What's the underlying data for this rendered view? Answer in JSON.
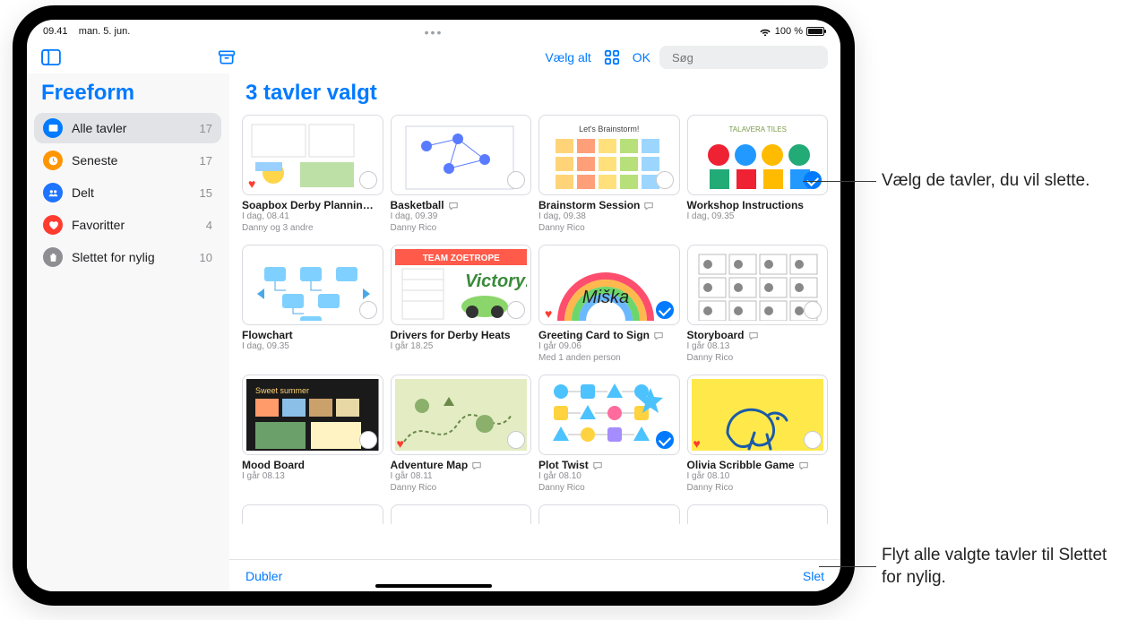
{
  "statusbar": {
    "time": "09.41",
    "date": "man. 5. jun.",
    "battery": "100 %"
  },
  "toolbar": {
    "select_all": "Vælg alt",
    "done": "OK",
    "search_placeholder": "Søg"
  },
  "sidebar": {
    "title": "Freeform",
    "items": [
      {
        "icon": "board",
        "color": "#007aff",
        "label": "Alle tavler",
        "count": "17",
        "active": true
      },
      {
        "icon": "clock",
        "color": "#ff9500",
        "label": "Seneste",
        "count": "17",
        "active": false
      },
      {
        "icon": "people",
        "color": "#1e73ff",
        "label": "Delt",
        "count": "15",
        "active": false
      },
      {
        "icon": "heart",
        "color": "#ff3b30",
        "label": "Favoritter",
        "count": "4",
        "active": false
      },
      {
        "icon": "trash",
        "color": "#8e8e93",
        "label": "Slettet for nylig",
        "count": "10",
        "active": false
      }
    ]
  },
  "main": {
    "header": "3 tavler valgt"
  },
  "boards": [
    {
      "title": "Soapbox Derby Plannin…",
      "sub1": "I dag, 08.41",
      "sub2": "Danny og 3 andre",
      "shared": false,
      "fav": true,
      "selected": false,
      "art": "art-derby"
    },
    {
      "title": "Basketball",
      "sub1": "I dag, 09.39",
      "sub2": "Danny Rico",
      "shared": true,
      "fav": false,
      "selected": false,
      "art": "art-graph"
    },
    {
      "title": "Brainstorm Session",
      "sub1": "I dag, 09.38",
      "sub2": "Danny Rico",
      "shared": true,
      "fav": false,
      "selected": false,
      "art": "art-sticky"
    },
    {
      "title": "Workshop Instructions",
      "sub1": "I dag, 09.35",
      "sub2": "",
      "shared": false,
      "fav": false,
      "selected": true,
      "art": "art-tiles"
    },
    {
      "title": "Flowchart",
      "sub1": "I dag, 09.35",
      "sub2": "",
      "shared": false,
      "fav": false,
      "selected": false,
      "art": "art-flow"
    },
    {
      "title": "Drivers for Derby Heats",
      "sub1": "I går 18.25",
      "sub2": "",
      "shared": false,
      "fav": false,
      "selected": false,
      "art": "art-zoe"
    },
    {
      "title": "Greeting Card to Sign",
      "sub1": "I går 09.06",
      "sub2": "Med 1 anden person",
      "shared": true,
      "fav": true,
      "selected": true,
      "art": "art-rainbow"
    },
    {
      "title": "Storyboard",
      "sub1": "I går 08.13",
      "sub2": "Danny Rico",
      "shared": true,
      "fav": false,
      "selected": false,
      "art": "art-story"
    },
    {
      "title": "Mood Board",
      "sub1": "I går 08.13",
      "sub2": "",
      "shared": false,
      "fav": false,
      "selected": false,
      "art": "art-photos"
    },
    {
      "title": "Adventure Map",
      "sub1": "I går 08.11",
      "sub2": "Danny Rico",
      "shared": true,
      "fav": true,
      "selected": false,
      "art": "art-map"
    },
    {
      "title": "Plot Twist",
      "sub1": "I går 08.10",
      "sub2": "Danny Rico",
      "shared": true,
      "fav": false,
      "selected": true,
      "art": "art-plot"
    },
    {
      "title": "Olivia Scribble Game",
      "sub1": "I går 08.10",
      "sub2": "Danny Rico",
      "shared": true,
      "fav": true,
      "selected": false,
      "art": "art-yellow"
    }
  ],
  "bottombar": {
    "duplicate": "Dubler",
    "delete": "Slet"
  },
  "callouts": {
    "c1": "Vælg de tavler, du vil slette.",
    "c2": "Flyt alle valgte tavler til Slettet for nylig."
  }
}
